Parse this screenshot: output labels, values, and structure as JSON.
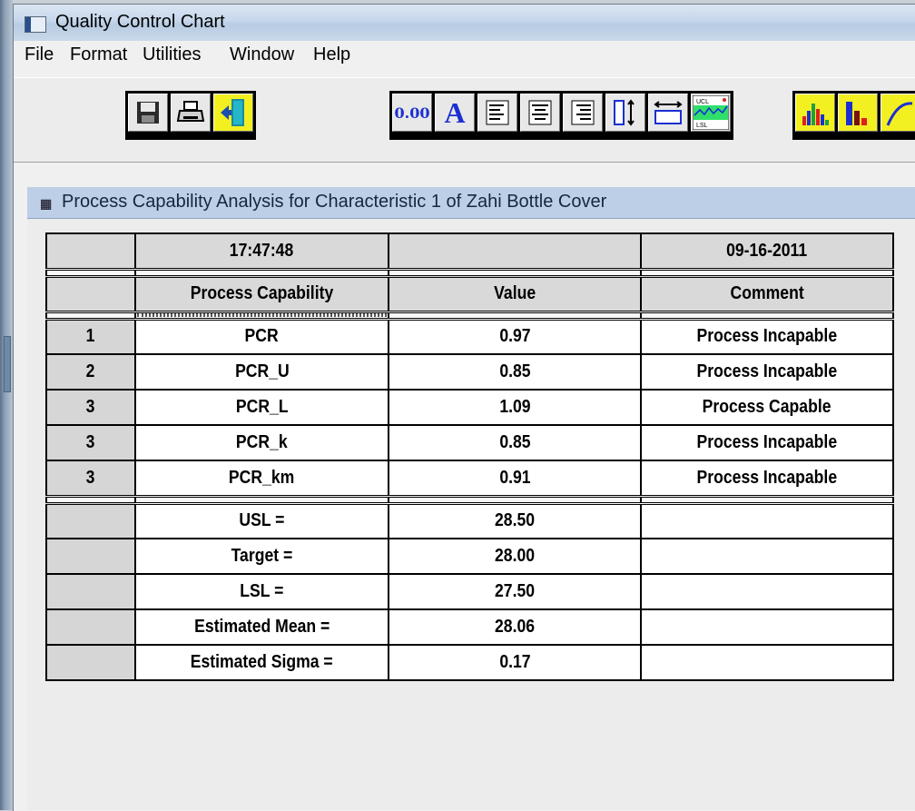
{
  "window": {
    "title": "Quality Control Chart"
  },
  "menu": [
    "File",
    "Format",
    "Utilities",
    "Window",
    "Help"
  ],
  "toolbar": {
    "decimal_label": "0.00",
    "font_label": "A",
    "chart_usl": "UCL",
    "chart_lsl": "LSL",
    "icons": [
      "save-icon",
      "print-icon",
      "exit-icon",
      "decimal-format-icon",
      "font-icon",
      "align-left-icon",
      "align-center-icon",
      "align-right-icon",
      "row-height-icon",
      "column-width-icon",
      "control-chart-icon",
      "histogram-icon",
      "bar-chart-icon",
      "curve-chart-icon"
    ]
  },
  "panel": {
    "title": "Process Capability Analysis for Characteristic 1 of Zahi Bottle Cover",
    "time": "17:47:48",
    "date": "09-16-2011",
    "headers": {
      "capability": "Process Capability",
      "value": "Value",
      "comment": "Comment"
    },
    "rows": [
      {
        "num": "1",
        "name": "PCR",
        "value": "0.97",
        "comment": "Process Incapable"
      },
      {
        "num": "2",
        "name": "PCR_U",
        "value": "0.85",
        "comment": "Process Incapable"
      },
      {
        "num": "3",
        "name": "PCR_L",
        "value": "1.09",
        "comment": "Process Capable"
      },
      {
        "num": "3",
        "name": "PCR_k",
        "value": "0.85",
        "comment": "Process Incapable"
      },
      {
        "num": "3",
        "name": "PCR_km",
        "value": "0.91",
        "comment": "Process Incapable"
      }
    ],
    "stats": [
      {
        "name": "USL =",
        "value": "28.50"
      },
      {
        "name": "Target =",
        "value": "28.00"
      },
      {
        "name": "LSL =",
        "value": "27.50"
      },
      {
        "name": "Estimated Mean =",
        "value": "28.06"
      },
      {
        "name": "Estimated Sigma =",
        "value": "0.17"
      }
    ]
  }
}
